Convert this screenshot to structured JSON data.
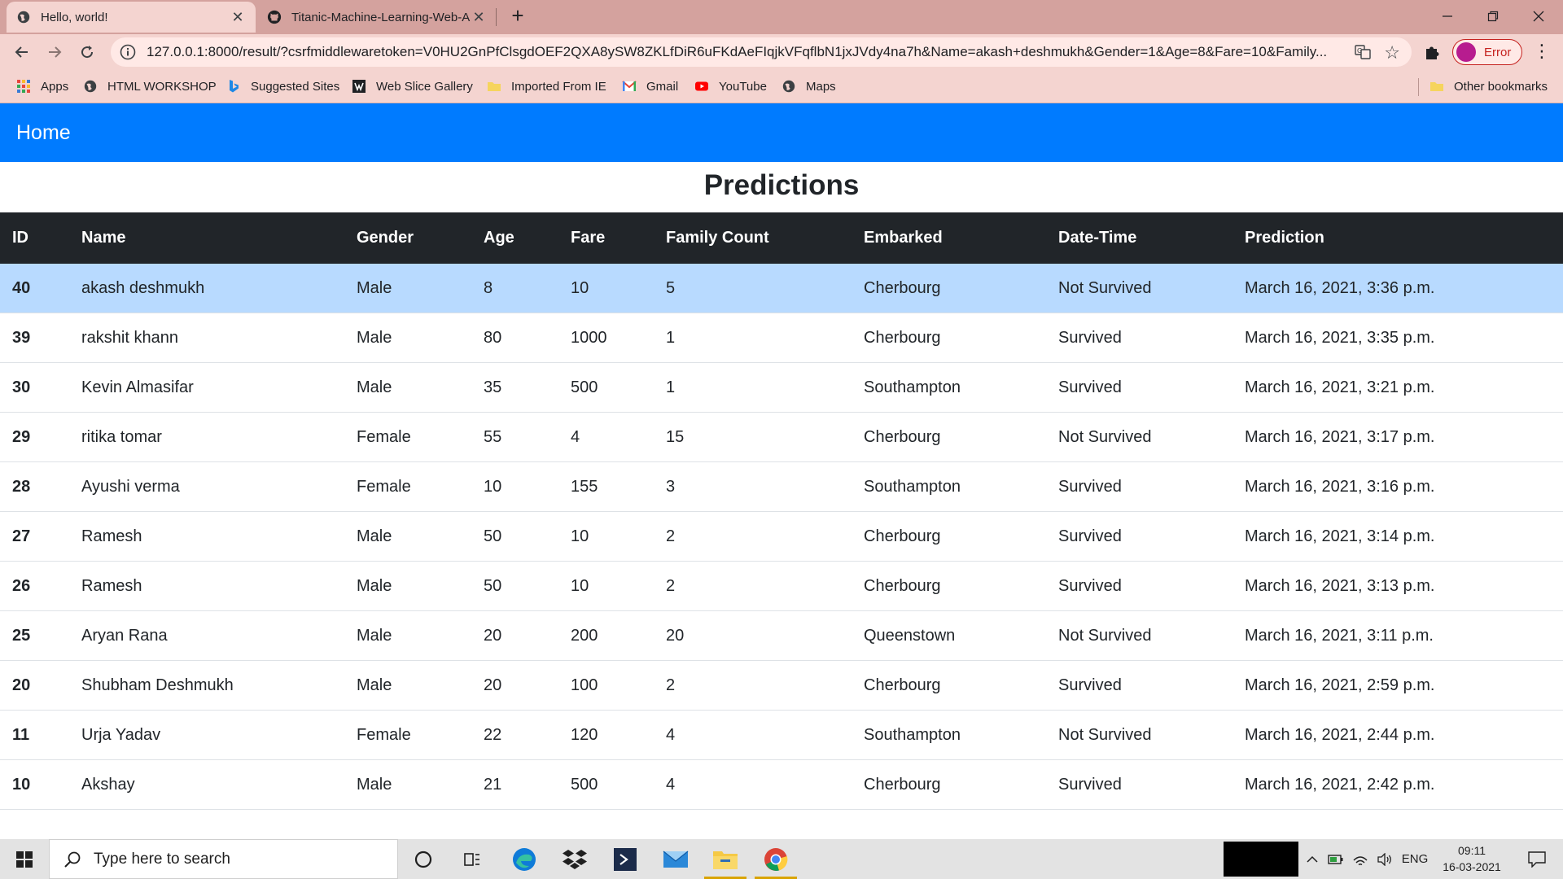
{
  "browser": {
    "tabs": [
      {
        "title": "Hello, world!",
        "active": true
      },
      {
        "title": "Titanic-Machine-Learning-Web-A",
        "active": false
      }
    ],
    "url": "127.0.0.1:8000/result/?csrfmiddlewaretoken=V0HU2GnPfClsgdOEF2QXA8ySW8ZKLfDiR6uFKdAeFIqjkVFqflbN1jxJVdy4na7h&Name=akash+deshmukh&Gender=1&Age=8&Fare=10&Family...",
    "profile_label": "Error",
    "bookmarks": [
      {
        "label": "Apps",
        "icon": "apps-grid-icon"
      },
      {
        "label": "HTML WORKSHOP",
        "icon": "globe-icon"
      },
      {
        "label": "Suggested Sites",
        "icon": "bing-icon"
      },
      {
        "label": "Web Slice Gallery",
        "icon": "web-slice-icon"
      },
      {
        "label": "Imported From IE",
        "icon": "folder-icon"
      },
      {
        "label": "Gmail",
        "icon": "gmail-icon"
      },
      {
        "label": "YouTube",
        "icon": "youtube-icon"
      },
      {
        "label": "Maps",
        "icon": "globe-icon"
      }
    ],
    "other_bookmarks": "Other bookmarks"
  },
  "navbar": {
    "brand": "Home"
  },
  "page": {
    "title": "Predictions"
  },
  "table": {
    "columns": [
      "ID",
      "Name",
      "Gender",
      "Age",
      "Fare",
      "Family Count",
      "Embarked",
      "Date-Time",
      "Prediction"
    ],
    "rows": [
      [
        "40",
        "akash deshmukh",
        "Male",
        "8",
        "10",
        "5",
        "Cherbourg",
        "Not Survived",
        "March 16, 2021, 3:36 p.m."
      ],
      [
        "39",
        "rakshit khann",
        "Male",
        "80",
        "1000",
        "1",
        "Cherbourg",
        "Survived",
        "March 16, 2021, 3:35 p.m."
      ],
      [
        "30",
        "Kevin Almasifar",
        "Male",
        "35",
        "500",
        "1",
        "Southampton",
        "Survived",
        "March 16, 2021, 3:21 p.m."
      ],
      [
        "29",
        "ritika tomar",
        "Female",
        "55",
        "4",
        "15",
        "Cherbourg",
        "Not Survived",
        "March 16, 2021, 3:17 p.m."
      ],
      [
        "28",
        "Ayushi verma",
        "Female",
        "10",
        "155",
        "3",
        "Southampton",
        "Survived",
        "March 16, 2021, 3:16 p.m."
      ],
      [
        "27",
        "Ramesh",
        "Male",
        "50",
        "10",
        "2",
        "Cherbourg",
        "Survived",
        "March 16, 2021, 3:14 p.m."
      ],
      [
        "26",
        "Ramesh",
        "Male",
        "50",
        "10",
        "2",
        "Cherbourg",
        "Survived",
        "March 16, 2021, 3:13 p.m."
      ],
      [
        "25",
        "Aryan Rana",
        "Male",
        "20",
        "200",
        "20",
        "Queenstown",
        "Not Survived",
        "March 16, 2021, 3:11 p.m."
      ],
      [
        "20",
        "Shubham Deshmukh",
        "Male",
        "20",
        "100",
        "2",
        "Cherbourg",
        "Survived",
        "March 16, 2021, 2:59 p.m."
      ],
      [
        "11",
        "Urja Yadav",
        "Female",
        "22",
        "120",
        "4",
        "Southampton",
        "Not Survived",
        "March 16, 2021, 2:44 p.m."
      ],
      [
        "10",
        "Akshay",
        "Male",
        "21",
        "500",
        "4",
        "Cherbourg",
        "Survived",
        "March 16, 2021, 2:42 p.m."
      ]
    ]
  },
  "taskbar": {
    "search_placeholder": "Type here to search",
    "language": "ENG",
    "time": "09:11",
    "date": "16-03-2021"
  },
  "colors": {
    "navbar": "#007bff",
    "table_header": "#212529",
    "active_row": "#b8daff",
    "chrome_frame": "#d4a29e"
  }
}
